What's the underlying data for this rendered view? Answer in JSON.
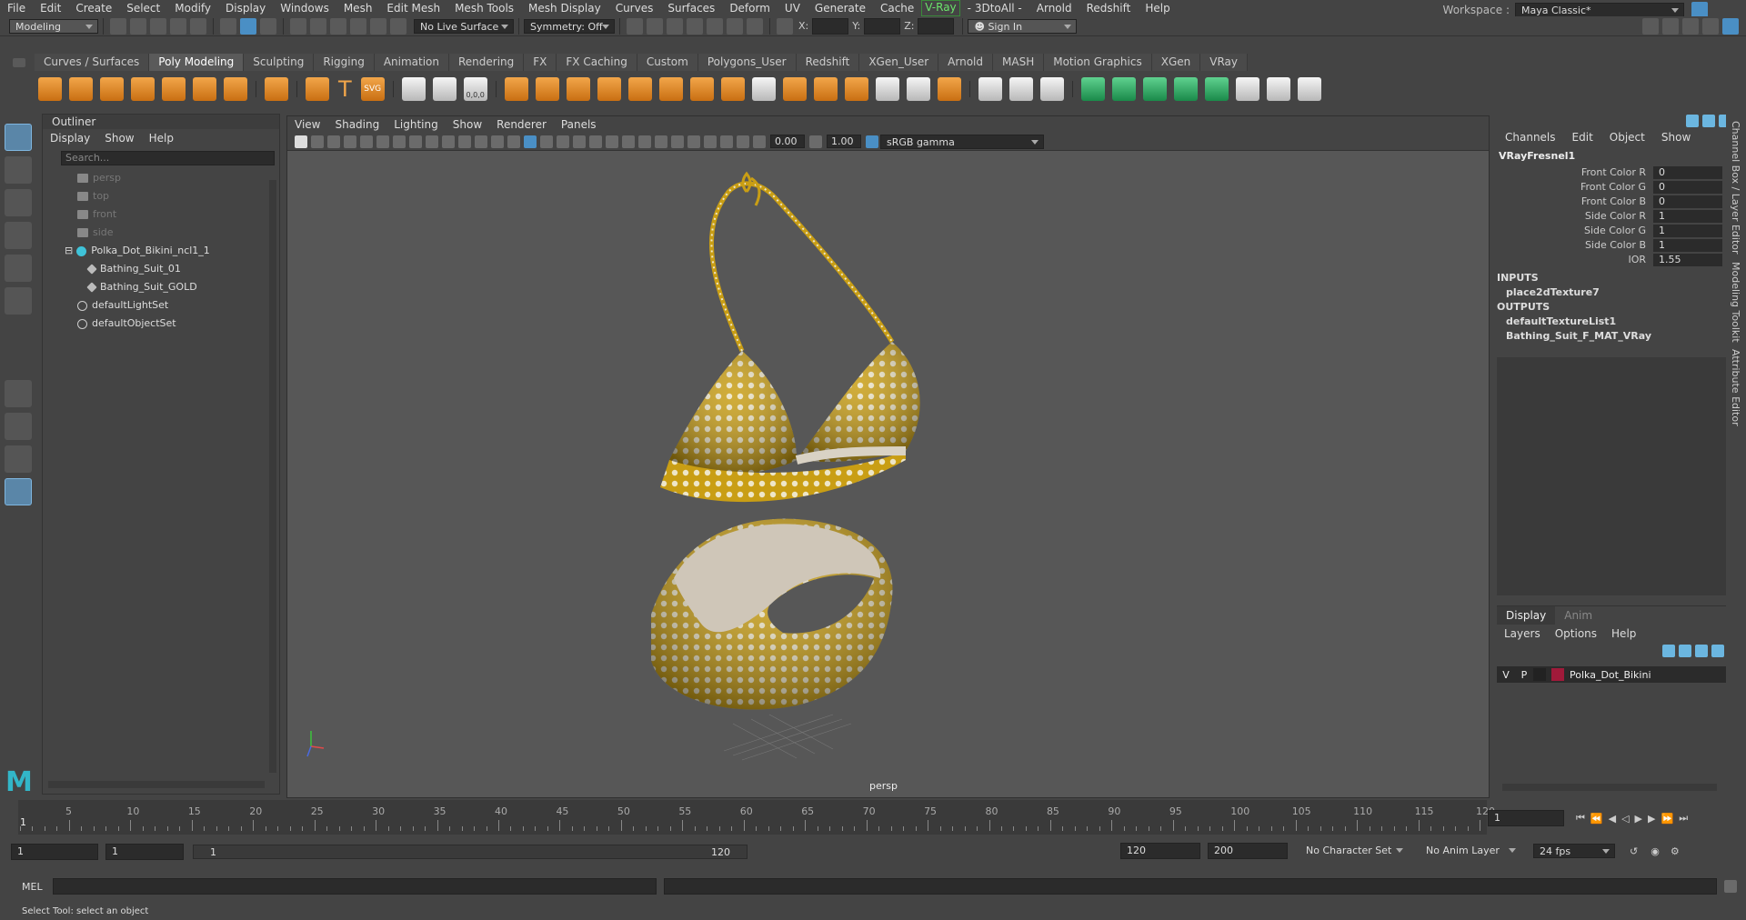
{
  "menubar": {
    "items": [
      "File",
      "Edit",
      "Create",
      "Select",
      "Modify",
      "Display",
      "Windows",
      "Mesh",
      "Edit Mesh",
      "Mesh Tools",
      "Mesh Display",
      "Curves",
      "Surfaces",
      "Deform",
      "UV",
      "Generate",
      "Cache"
    ],
    "vray": "V-Ray",
    "items2": [
      "- 3DtoAll -",
      "Arnold",
      "Redshift",
      "Help"
    ],
    "workspace_label": "Workspace :",
    "workspace_value": "Maya Classic*"
  },
  "statusline": {
    "mode": "Modeling",
    "live_surface": "No Live Surface",
    "symmetry": "Symmetry: Off",
    "x_label": "X:",
    "y_label": "Y:",
    "z_label": "Z:",
    "sign_in": "Sign In"
  },
  "shelf": {
    "tabs": [
      "Curves / Surfaces",
      "Poly Modeling",
      "Sculpting",
      "Rigging",
      "Animation",
      "Rendering",
      "FX",
      "FX Caching",
      "Custom",
      "Polygons_User",
      "Redshift",
      "XGen_User",
      "Arnold",
      "MASH",
      "Motion Graphics",
      "XGen",
      "VRay"
    ],
    "active_tab": "Poly Modeling",
    "text_tool": "T",
    "svg_tool": "SVG",
    "coord": "0,0,0"
  },
  "outliner": {
    "title": "Outliner",
    "menu": [
      "Display",
      "Show",
      "Help"
    ],
    "search_placeholder": "Search...",
    "items": [
      {
        "label": "persp",
        "dim": true,
        "type": "camera"
      },
      {
        "label": "top",
        "dim": true,
        "type": "camera"
      },
      {
        "label": "front",
        "dim": true,
        "type": "camera"
      },
      {
        "label": "side",
        "dim": true,
        "type": "camera"
      },
      {
        "label": "Polka_Dot_Bikini_ncl1_1",
        "dim": false,
        "type": "group"
      },
      {
        "label": "Bathing_Suit_01",
        "dim": false,
        "type": "mesh"
      },
      {
        "label": "Bathing_Suit_GOLD",
        "dim": false,
        "type": "mesh"
      },
      {
        "label": "defaultLightSet",
        "dim": false,
        "type": "set"
      },
      {
        "label": "defaultObjectSet",
        "dim": false,
        "type": "set"
      }
    ]
  },
  "viewport": {
    "menu": [
      "View",
      "Shading",
      "Lighting",
      "Show",
      "Renderer",
      "Panels"
    ],
    "exposure": "0.00",
    "gamma_value": "1.00",
    "color_space": "sRGB gamma",
    "camera_label": "persp"
  },
  "channel_box": {
    "menu": [
      "Channels",
      "Edit",
      "Object",
      "Show"
    ],
    "node": "VRayFresnel1",
    "attrs": [
      {
        "name": "Front Color R",
        "value": "0"
      },
      {
        "name": "Front Color G",
        "value": "0"
      },
      {
        "name": "Front Color B",
        "value": "0"
      },
      {
        "name": "Side Color R",
        "value": "1"
      },
      {
        "name": "Side Color G",
        "value": "1"
      },
      {
        "name": "Side Color B",
        "value": "1"
      },
      {
        "name": "IOR",
        "value": "1.55"
      }
    ],
    "inputs_label": "INPUTS",
    "inputs": [
      "place2dTexture7"
    ],
    "outputs_label": "OUTPUTS",
    "outputs": [
      "defaultTextureList1",
      "Bathing_Suit_F_MAT_VRay"
    ]
  },
  "layer_editor": {
    "tabs": [
      "Display",
      "Anim"
    ],
    "active_tab": "Display",
    "menu": [
      "Layers",
      "Options",
      "Help"
    ],
    "layer": {
      "v": "V",
      "p": "P",
      "name": "Polka_Dot_Bikini",
      "color": "#a01a3a"
    }
  },
  "side_tabs": [
    "Channel Box / Layer Editor",
    "Modeling Toolkit",
    "Attribute Editor"
  ],
  "timeline": {
    "ticks": [
      "5",
      "10",
      "15",
      "20",
      "25",
      "30",
      "35",
      "40",
      "45",
      "50",
      "55",
      "60",
      "65",
      "70",
      "75",
      "80",
      "85",
      "90",
      "95",
      "100",
      "105",
      "110",
      "115",
      "120"
    ],
    "start_marker": "1",
    "current_frame": "1"
  },
  "range": {
    "start": "1",
    "anim_start": "1",
    "slider_start": "1",
    "slider_end": "120",
    "end": "120",
    "anim_end": "200",
    "character_set": "No Character Set",
    "anim_layer": "No Anim Layer",
    "fps": "24 fps"
  },
  "command": {
    "label": "MEL"
  },
  "help_line": "Select Tool: select an object",
  "colors": {
    "accent": "#5a86a8",
    "bikini": "#d4a91c",
    "layer": "#a01a3a"
  }
}
